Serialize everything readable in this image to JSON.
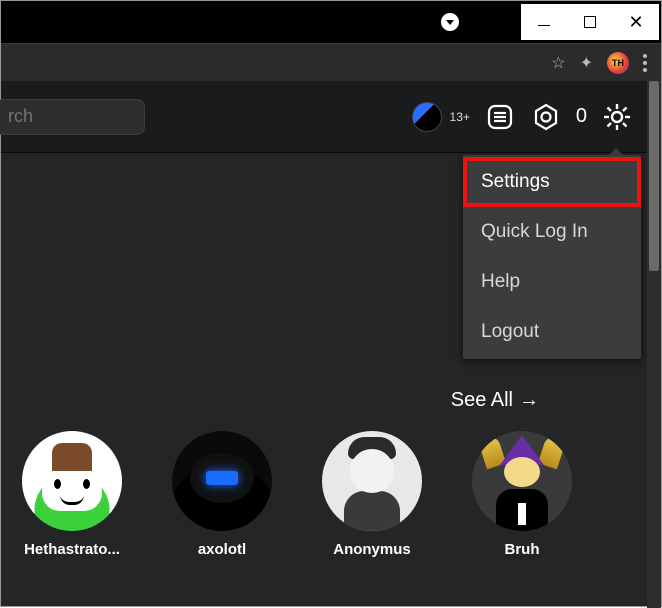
{
  "browser": {
    "profile_label": "TH"
  },
  "header": {
    "search_placeholder": "rch",
    "age_badge": "13+",
    "robux_count": "0"
  },
  "settings_menu": {
    "items": [
      {
        "label": "Settings"
      },
      {
        "label": "Quick Log In"
      },
      {
        "label": "Help"
      },
      {
        "label": "Logout"
      }
    ]
  },
  "friends": {
    "see_all_label": "See All",
    "list": [
      {
        "name": "Hethastrato..."
      },
      {
        "name": "axolotl"
      },
      {
        "name": "Anonymus"
      },
      {
        "name": "Bruh"
      }
    ]
  }
}
